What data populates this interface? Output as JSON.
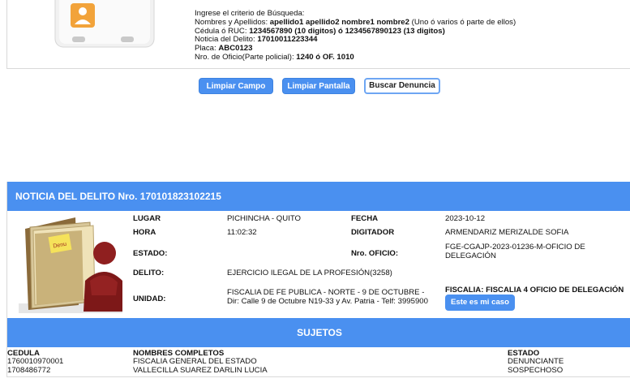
{
  "search": {
    "intro": "Ingrese el criterio de Búsqueda:",
    "lines": [
      {
        "label": "Nombres y Apellidos: ",
        "example": "apellido1 apellido2 nombre1 nombre2",
        "note": " (Uno ó varios ó parte de ellos)"
      },
      {
        "label": "Cédula ó RUC: ",
        "example": "1234567890 (10 digitos) ó 1234567890123 (13 digitos)",
        "note": ""
      },
      {
        "label": "Noticia del Delito: ",
        "example": "17010011223344",
        "note": ""
      },
      {
        "label": "Placa: ",
        "example": "ABC0123",
        "note": ""
      },
      {
        "label": "Nro. de Oficio(Parte policial): ",
        "example": "1240 ó OF. 1010",
        "note": ""
      }
    ]
  },
  "buttons": {
    "clear_field": "Limpiar    Campo",
    "clear_screen": "Limpiar  Pantalla",
    "search": "Buscar Denuncia"
  },
  "result": {
    "title": "NOTICIA DEL DELITO Nro. 170101823102215",
    "labels": {
      "lugar": "LUGAR",
      "fecha": "FECHA",
      "hora": "HORA",
      "digitador": "DIGITADOR",
      "estado": "ESTADO:",
      "oficio": "Nro. OFICIO:",
      "delito": "DELITO:",
      "unidad": "UNIDAD:",
      "fiscalia": "FISCALIA: FISCALIA 4 OFICIO DE DELEGACIÓN"
    },
    "values": {
      "lugar": "PICHINCHA - QUITO",
      "fecha": "2023-10-12",
      "hora": "11:02:32",
      "digitador": "ARMENDARIZ MERIZALDE SOFIA",
      "estado": "",
      "oficio_1": "FGE-CGAJP-2023-01236-M-OFICIO DE",
      "oficio_2": "DELEGACIÓN",
      "delito": "EJERCICIO ILEGAL DE LA PROFESIÓN(3258)",
      "unidad_1": "FISCALIA DE FE PUBLICA - NORTE - 9 DE OCTUBRE -",
      "unidad_2": "Dir: Calle 9 de Octubre N19-33 y Av. Patria - Telf: 3995900"
    },
    "case_button": "Este es mi caso",
    "folder_note": "Denu"
  },
  "sujetos": {
    "title": "SUJETOS",
    "headers": [
      "CEDULA",
      "NOMBRES COMPLETOS",
      "ESTADO"
    ],
    "rows": [
      [
        "1760010970001",
        "FISCALIA GENERAL DEL ESTADO",
        "DENUNCIANTE"
      ],
      [
        "1708486772",
        "VALLECILLA SUAREZ DARLIN LUCIA",
        "SOSPECHOSO"
      ]
    ]
  },
  "colors": {
    "accent": "#4a90f0",
    "white": "#ffffff"
  }
}
